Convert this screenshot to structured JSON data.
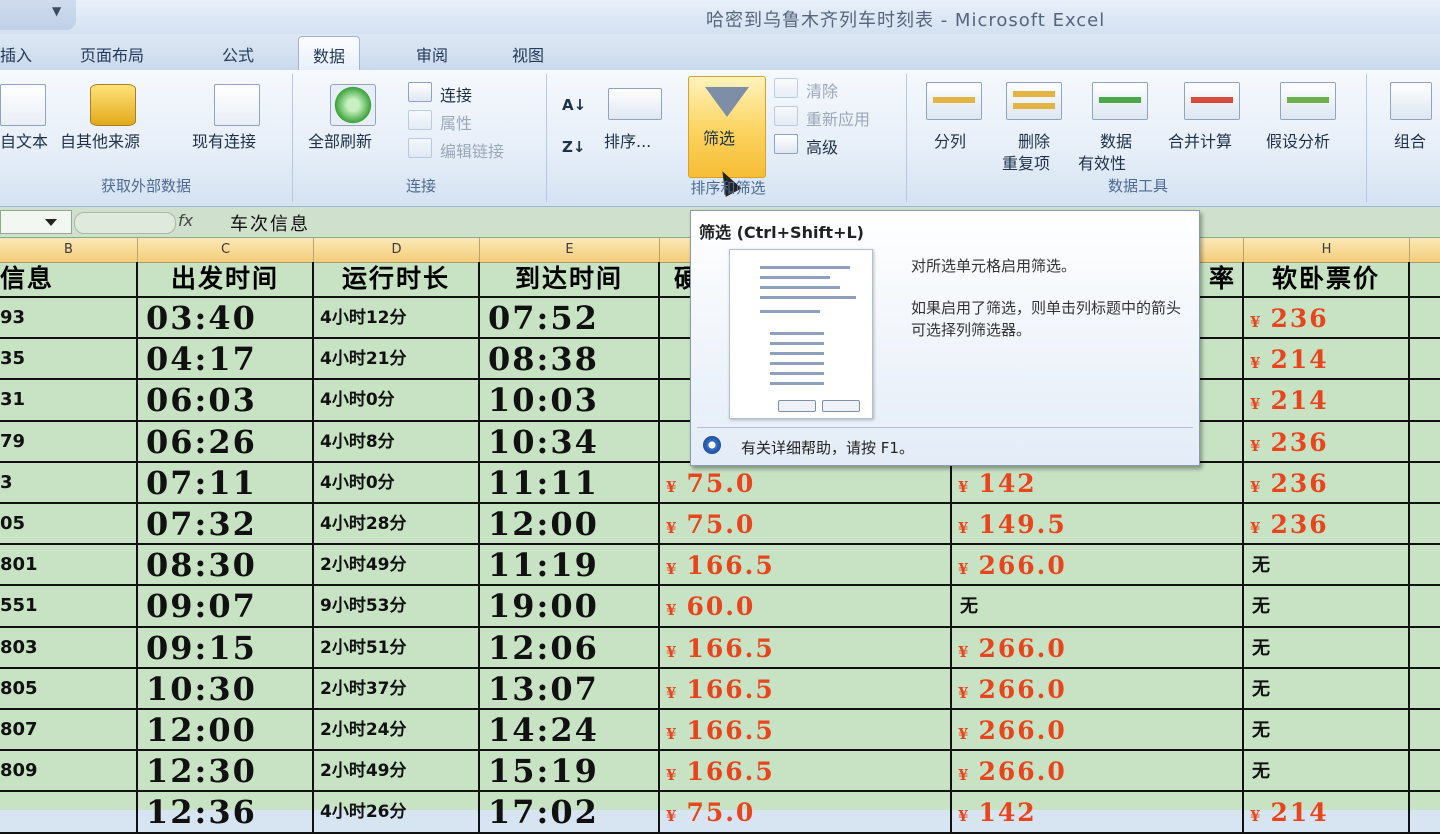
{
  "window": {
    "title": "哈密到乌鲁木齐列车时刻表 - Microsoft Excel",
    "qat_dropdown": "▼"
  },
  "tabs": [
    {
      "label": "插入"
    },
    {
      "label": "页面布局"
    },
    {
      "label": "公式"
    },
    {
      "label": "数据"
    },
    {
      "label": "审阅"
    },
    {
      "label": "视图"
    }
  ],
  "ribbon": {
    "external_data": {
      "from_text": "自文本",
      "from_other": "自其他来源",
      "existing": "现有连接",
      "group_label": "获取外部数据"
    },
    "connections": {
      "refresh_all": "全部刷新",
      "connections": "连接",
      "properties": "属性",
      "edit_links": "编辑链接",
      "group_label": "连接"
    },
    "sort_filter": {
      "sort": "排序...",
      "filter": "筛选",
      "clear": "清除",
      "reapply": "重新应用",
      "advanced": "高级",
      "group_label": "排序和筛选"
    },
    "data_tools": {
      "text_to_columns": "分列",
      "remove_dup_1": "删除",
      "remove_dup_2": "重复项",
      "validation_1": "数据",
      "validation_2": "有效性",
      "consolidate": "合并计算",
      "what_if": "假设分析",
      "group_label": "数据工具"
    },
    "outline": {
      "group": "组合"
    }
  },
  "formula_bar": {
    "fx": "fx",
    "value": "车次信息"
  },
  "column_letters": [
    "B",
    "C",
    "D",
    "E",
    "H"
  ],
  "header_row": {
    "b": "信息",
    "c": "出发时间",
    "d": "运行时长",
    "e": "到达时间",
    "f": "硬",
    "g": "率",
    "h": "软卧票价"
  },
  "rows": [
    {
      "b": "93",
      "c": "03:40",
      "d": "4小时12分",
      "e": "07:52",
      "h": "236"
    },
    {
      "b": "35",
      "c": "04:17",
      "d": "4小时21分",
      "e": "08:38",
      "h": "214"
    },
    {
      "b": "31",
      "c": "06:03",
      "d": "4小时0分",
      "e": "10:03",
      "h": "214"
    },
    {
      "b": "79",
      "c": "06:26",
      "d": "4小时8分",
      "e": "10:34",
      "h": "236"
    },
    {
      "b": "3",
      "c": "07:11",
      "d": "4小时0分",
      "e": "11:11",
      "f": "75.0",
      "g": "142",
      "h": "236"
    },
    {
      "b": "05",
      "c": "07:32",
      "d": "4小时28分",
      "e": "12:00",
      "f": "75.0",
      "g": "149.5",
      "h": "236"
    },
    {
      "b": "801",
      "c": "08:30",
      "d": "2小时49分",
      "e": "11:19",
      "f": "166.5",
      "g": "266.0",
      "h_none": "无"
    },
    {
      "b": "551",
      "c": "09:07",
      "d": "9小时53分",
      "e": "19:00",
      "f": "60.0",
      "g_none": "无",
      "h_none": "无"
    },
    {
      "b": "803",
      "c": "09:15",
      "d": "2小时51分",
      "e": "12:06",
      "f": "166.5",
      "g": "266.0",
      "h_none": "无"
    },
    {
      "b": "805",
      "c": "10:30",
      "d": "2小时37分",
      "e": "13:07",
      "f": "166.5",
      "g": "266.0",
      "h_none": "无"
    },
    {
      "b": "807",
      "c": "12:00",
      "d": "2小时24分",
      "e": "14:24",
      "f": "166.5",
      "g": "266.0",
      "h_none": "无"
    },
    {
      "b": "809",
      "c": "12:30",
      "d": "2小时49分",
      "e": "15:19",
      "f": "166.5",
      "g": "266.0",
      "h_none": "无"
    },
    {
      "b": "",
      "c": "12:36",
      "d": "4小时26分",
      "e": "17:02",
      "f": "75.0",
      "g": "142",
      "h": "214"
    }
  ],
  "yen": "¥",
  "tooltip": {
    "title": "筛选 (Ctrl+Shift+L)",
    "line1": "对所选单元格启用筛选。",
    "line2": "如果启用了筛选，则单击列标题中的箭头可选择列筛选器。",
    "help": "有关详细帮助，请按 F1。"
  }
}
